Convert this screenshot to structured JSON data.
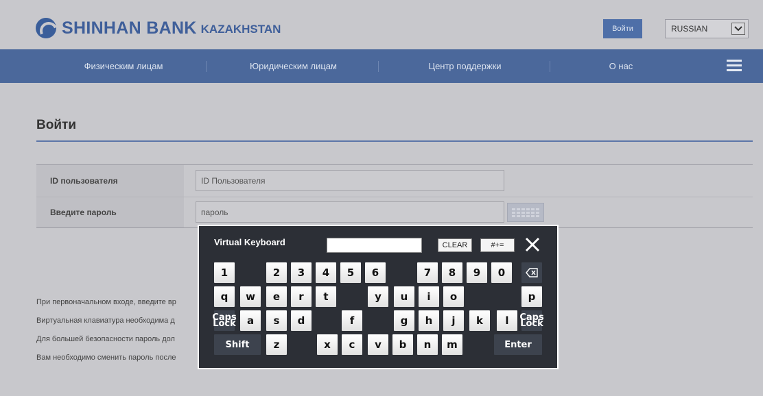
{
  "header": {
    "logo_text": "SHINHAN BANK",
    "logo_sub": "KAZAKHSTAN",
    "login_label": "Войти",
    "language": "RUSSIAN"
  },
  "nav": {
    "items": [
      {
        "label": "Физическим лицам"
      },
      {
        "label": "Юридическим лицам"
      },
      {
        "label": "Центр поддержки"
      },
      {
        "label": "О нас"
      }
    ]
  },
  "page": {
    "title": "Войти",
    "user_id_label": "ID пользователя",
    "user_id_placeholder": "ID Пользователя",
    "password_label": "Введите пароль",
    "password_placeholder": "пароль",
    "info_lines": [
      "При первоначальном входе, введите вр",
      "Виртуальная клавиатура необходима д",
      "Для большей безопасности пароль дол",
      "Вам необходимо сменить пароль после"
    ]
  },
  "keyboard": {
    "title": "Virtual Keyboard",
    "clear_label": "CLEAR",
    "symbols_label": "#+=",
    "keys": {
      "k1": "1",
      "k2": "2",
      "k3": "3",
      "k4": "4",
      "k5": "5",
      "k6": "6",
      "k7": "7",
      "k8": "8",
      "k9": "9",
      "k0": "0",
      "q": "q",
      "w": "w",
      "e": "e",
      "r": "r",
      "t": "t",
      "y": "y",
      "u": "u",
      "i": "i",
      "o": "o",
      "p": "p",
      "caps": "Caps\nLock",
      "a": "a",
      "s": "s",
      "d": "d",
      "f": "f",
      "g": "g",
      "h": "h",
      "j": "j",
      "k": "k",
      "l": "l",
      "shift": "Shift",
      "z": "z",
      "x": "x",
      "c": "c",
      "v": "v",
      "b": "b",
      "n": "n",
      "m": "m",
      "enter": "Enter"
    }
  },
  "colors": {
    "nav_bg": "#4b689b",
    "brand": "#3f5f9a",
    "keyboard_bg": "#2c2f36"
  }
}
